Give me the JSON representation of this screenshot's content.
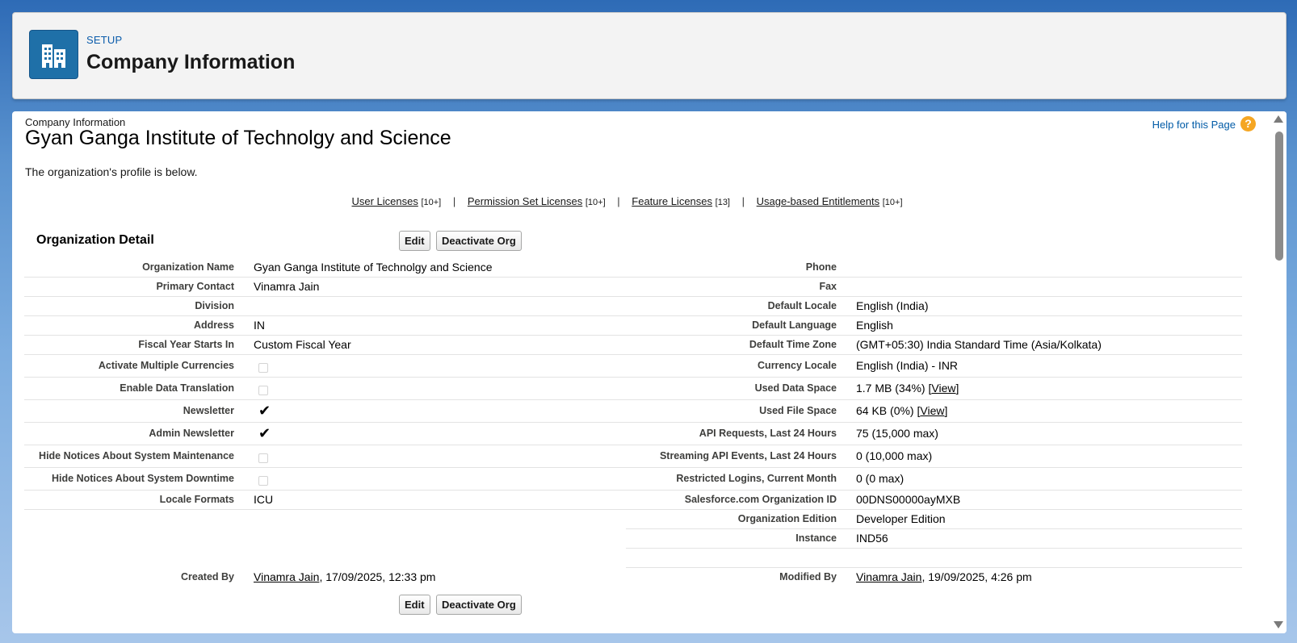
{
  "header": {
    "eyebrow": "SETUP",
    "title": "Company Information",
    "icon": "building-icon"
  },
  "content": {
    "breadcrumb": "Company Information",
    "org_title": "Gyan Ganga Institute of Technolgy and Science",
    "intro": "The organization's profile is below.",
    "help_link": "Help for this Page",
    "help_icon": "?"
  },
  "licenses": [
    {
      "label": "User Licenses",
      "count": "[10+]"
    },
    {
      "label": "Permission Set Licenses",
      "count": "[10+]"
    },
    {
      "label": "Feature Licenses",
      "count": "[13]"
    },
    {
      "label": "Usage-based Entitlements",
      "count": "[10+]"
    }
  ],
  "licenses_separator": "|",
  "section": {
    "title": "Organization Detail",
    "edit_label": "Edit",
    "deactivate_label": "Deactivate Org"
  },
  "left_fields": [
    {
      "label": "Organization Name",
      "value": "Gyan Ganga Institute of Technolgy and Science"
    },
    {
      "label": "Primary Contact",
      "value": "Vinamra Jain"
    },
    {
      "label": "Division",
      "value": ""
    },
    {
      "label": "Address",
      "value": "IN"
    },
    {
      "label": "Fiscal Year Starts In",
      "value": "Custom Fiscal Year"
    },
    {
      "label": "Activate Multiple Currencies",
      "checked": false
    },
    {
      "label": "Enable Data Translation",
      "checked": false
    },
    {
      "label": "Newsletter",
      "checked": true
    },
    {
      "label": "Admin Newsletter",
      "checked": true
    },
    {
      "label": "Hide Notices About System Maintenance",
      "checked": false
    },
    {
      "label": "Hide Notices About System Downtime",
      "checked": false
    },
    {
      "label": "Locale Formats",
      "value": "ICU"
    }
  ],
  "right_fields": [
    {
      "label": "Phone",
      "value": ""
    },
    {
      "label": "Fax",
      "value": ""
    },
    {
      "label": "Default Locale",
      "value": "English (India)"
    },
    {
      "label": "Default Language",
      "value": "English"
    },
    {
      "label": "Default Time Zone",
      "value": "(GMT+05:30) India Standard Time (Asia/Kolkata)"
    },
    {
      "label": "Currency Locale",
      "value": "English (India) - INR"
    },
    {
      "label": "Used Data Space",
      "value": "1.7 MB (34%)",
      "link": "View"
    },
    {
      "label": "Used File Space",
      "value": "64 KB (0%)",
      "link": "View"
    },
    {
      "label": "API Requests, Last 24 Hours",
      "value": "75 (15,000 max)"
    },
    {
      "label": "Streaming API Events, Last 24 Hours",
      "value": "0 (10,000 max)"
    },
    {
      "label": "Restricted Logins, Current Month",
      "value": "0 (0 max)"
    },
    {
      "label": "Salesforce.com Organization ID",
      "value": "00DNS00000ayMXB"
    },
    {
      "label": "Organization Edition",
      "value": "Developer Edition"
    },
    {
      "label": "Instance",
      "value": "IND56"
    }
  ],
  "created": {
    "label": "Created By",
    "user": "Vinamra Jain",
    "date": ", 17/09/2025, 12:33 pm"
  },
  "modified": {
    "label": "Modified By",
    "user": "Vinamra Jain",
    "date": ", 19/09/2025, 4:26 pm"
  }
}
